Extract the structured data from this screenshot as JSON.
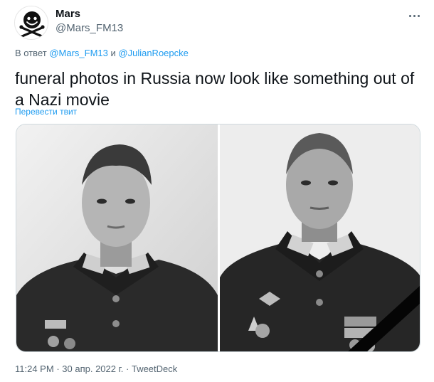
{
  "author": {
    "display_name": "Mars",
    "handle": "@Mars_FM13"
  },
  "reply": {
    "prefix": "В ответ",
    "user1": "@Mars_FM13",
    "conj": "и",
    "user2": "@JulianRoepcke"
  },
  "tweet": {
    "text": "funeral photos in Russia now look like something out of a Nazi movie",
    "translate_label": "Перевести твит"
  },
  "media": {
    "photos": [
      {
        "description": "black-and-white portrait of a young man in military uniform"
      },
      {
        "description": "black-and-white portrait of a man in military uniform with medals and black mourning ribbon"
      }
    ]
  },
  "meta": {
    "time": "11:24 PM",
    "sep": "·",
    "date": "30 апр. 2022 г.",
    "sep2": "·",
    "source": "TweetDeck"
  },
  "colors": {
    "accent": "#1d9bf0",
    "text": "#0f1419",
    "muted": "#536471"
  }
}
